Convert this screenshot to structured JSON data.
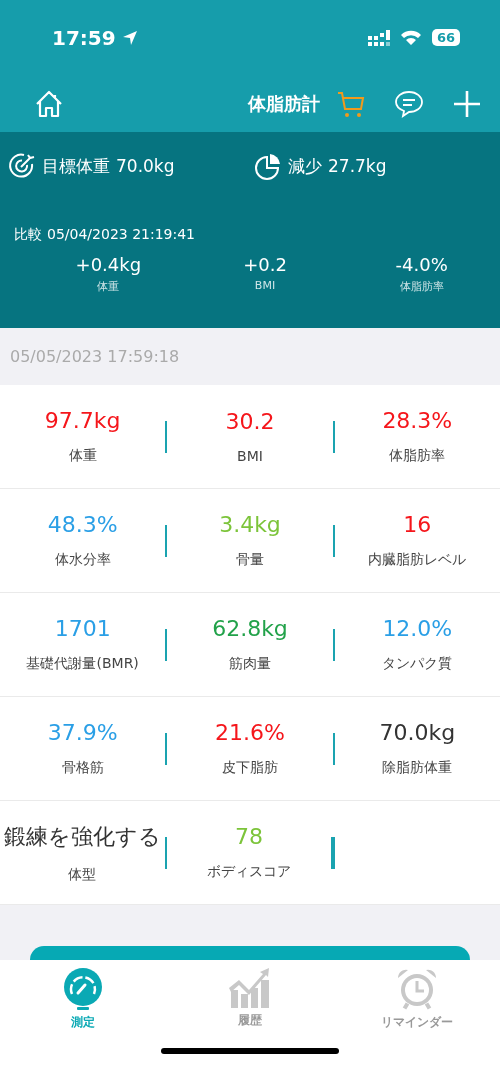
{
  "status_bar": {
    "time": "17:59",
    "battery": "66"
  },
  "header": {
    "title": "体脂肪計"
  },
  "summary": {
    "goal_label": "目標体重",
    "goal_value": "70.0kg",
    "loss_label": "減少",
    "loss_value": "27.7kg",
    "compare_label": "比較",
    "compare_time": "05/04/2023 21:19:41",
    "deltas": [
      {
        "value": "+0.4kg",
        "label": "体重"
      },
      {
        "value": "+0.2",
        "label": "BMI"
      },
      {
        "value": "-4.0%",
        "label": "体脂肪率"
      }
    ]
  },
  "measured_at": "05/05/2023 17:59:18",
  "metrics": [
    {
      "value": "97.7kg",
      "label": "体重",
      "color": "#f5161b"
    },
    {
      "value": "30.2",
      "label": "BMI",
      "color": "#f5161b"
    },
    {
      "value": "28.3%",
      "label": "体脂肪率",
      "color": "#f5161b"
    },
    {
      "value": "48.3%",
      "label": "体水分率",
      "color": "#2a9fe6"
    },
    {
      "value": "3.4kg",
      "label": "骨量",
      "color": "#7cc43a"
    },
    {
      "value": "16",
      "label": "内臓脂肪レベル",
      "color": "#f5161b"
    },
    {
      "value": "1701",
      "label": "基礎代謝量(BMR)",
      "color": "#2a9fe6"
    },
    {
      "value": "62.8kg",
      "label": "筋肉量",
      "color": "#22a24a"
    },
    {
      "value": "12.0%",
      "label": "タンパク質",
      "color": "#2a9fe6"
    },
    {
      "value": "37.9%",
      "label": "骨格筋",
      "color": "#2a9fe6"
    },
    {
      "value": "21.6%",
      "label": "皮下脂肪",
      "color": "#f5161b"
    },
    {
      "value": "70.0kg",
      "label": "除脂肪体重",
      "color": "#333333"
    },
    {
      "value": "鍛練を強化する",
      "label": "体型",
      "color": "#333333"
    },
    {
      "value": "78",
      "label": "ボディスコア",
      "color": "#7cc43a"
    }
  ],
  "tabs": [
    {
      "kind": "measure",
      "label": "測定",
      "selected": true
    },
    {
      "kind": "history",
      "label": "履歴",
      "selected": false
    },
    {
      "kind": "reminder",
      "label": "リマインダー",
      "selected": false
    }
  ]
}
